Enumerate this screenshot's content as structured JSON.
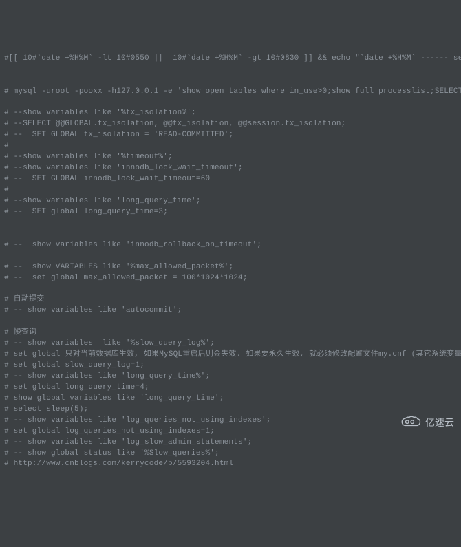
{
  "lines": [
    "#[[ 10#`date +%H%M` -lt 10#0550 ||  10#`date +%H%M` -gt 10#0830 ]] && echo \"`date +%H%M` ------ se",
    "",
    "",
    "# mysql -uroot -pooxx -h127.0.0.1 -e 'show open tables where in_use>0;show full processlist;SELECT ",
    "",
    "# --show variables like '%tx_isolation%';",
    "# --SELECT @@GLOBAL.tx_isolation, @@tx_isolation, @@session.tx_isolation;",
    "# --  SET GLOBAL tx_isolation = 'READ-COMMITTED';",
    "#",
    "# --show variables like '%timeout%';",
    "# --show variables like 'innodb_lock_wait_timeout';",
    "# --  SET GLOBAL innodb_lock_wait_timeout=60",
    "#",
    "# --show variables like 'long_query_time';",
    "# --  SET global long_query_time=3;",
    "",
    "",
    "# --  show variables like 'innodb_rollback_on_timeout';",
    "",
    "# --  show VARIABLES like '%max_allowed_packet%';",
    "# --  set global max_allowed_packet = 100*1024*1024;",
    "",
    "# 自动提交",
    "# -- show variables like 'autocommit';",
    "",
    "# 慢查询",
    "# -- show variables  like '%slow_query_log%';",
    "# set global 只对当前数据库生效, 如果MySQL重启后则会失效. 如果要永久生效, 就必须修改配置文件my.cnf (其它系统变量也",
    "# set global slow_query_log=1;",
    "# -- show variables like 'long_query_time%';",
    "# set global long_query_time=4;",
    "# show global variables like 'long_query_time';",
    "# select sleep(5);",
    "# -- show variables like 'log_queries_not_using_indexes';",
    "# set global log_queries_not_using_indexes=1;",
    "# -- show variables like 'log_slow_admin_statements';",
    "# -- show global status like '%Slow_queries%';",
    "# http://www.cnblogs.com/kerrycode/p/5593204.html"
  ],
  "watermark": {
    "text": "亿速云"
  }
}
